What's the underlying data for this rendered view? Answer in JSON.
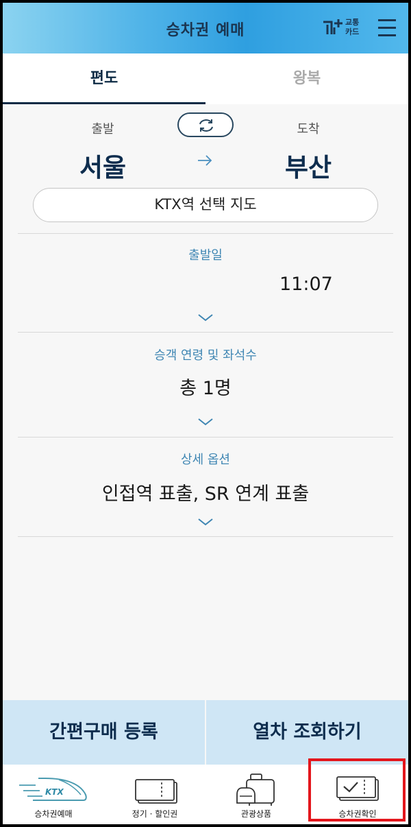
{
  "header": {
    "title": "승차권 예매",
    "card_logo_line1": "교통",
    "card_logo_line2": "카드"
  },
  "tabs": [
    {
      "label": "편도",
      "active": true
    },
    {
      "label": "왕복",
      "active": false
    }
  ],
  "route": {
    "departure_label": "출발",
    "departure_station": "서울",
    "arrival_label": "도착",
    "arrival_station": "부산",
    "map_button": "KTX역 선택 지도"
  },
  "sections": {
    "date": {
      "label": "출발일",
      "time": "11:07"
    },
    "passengers": {
      "label": "승객 연령 및 좌석수",
      "value": "총 1명"
    },
    "options": {
      "label": "상세 옵션",
      "value": "인접역 표출, SR 연계 표출"
    }
  },
  "actions": {
    "simple_purchase": "간편구매 등록",
    "search_trains": "열차 조회하기"
  },
  "tabbar": [
    {
      "label": "승차권예매",
      "icon": "ktx-train-icon"
    },
    {
      "label": "정기 · 할인권",
      "icon": "ticket-icon"
    },
    {
      "label": "관광상품",
      "icon": "luggage-icon"
    },
    {
      "label": "승차권확인",
      "icon": "ticket-check-icon"
    }
  ],
  "colors": {
    "accent": "#0e2d4e",
    "label_blue": "#3f86b3",
    "highlight": "#e3161c"
  }
}
